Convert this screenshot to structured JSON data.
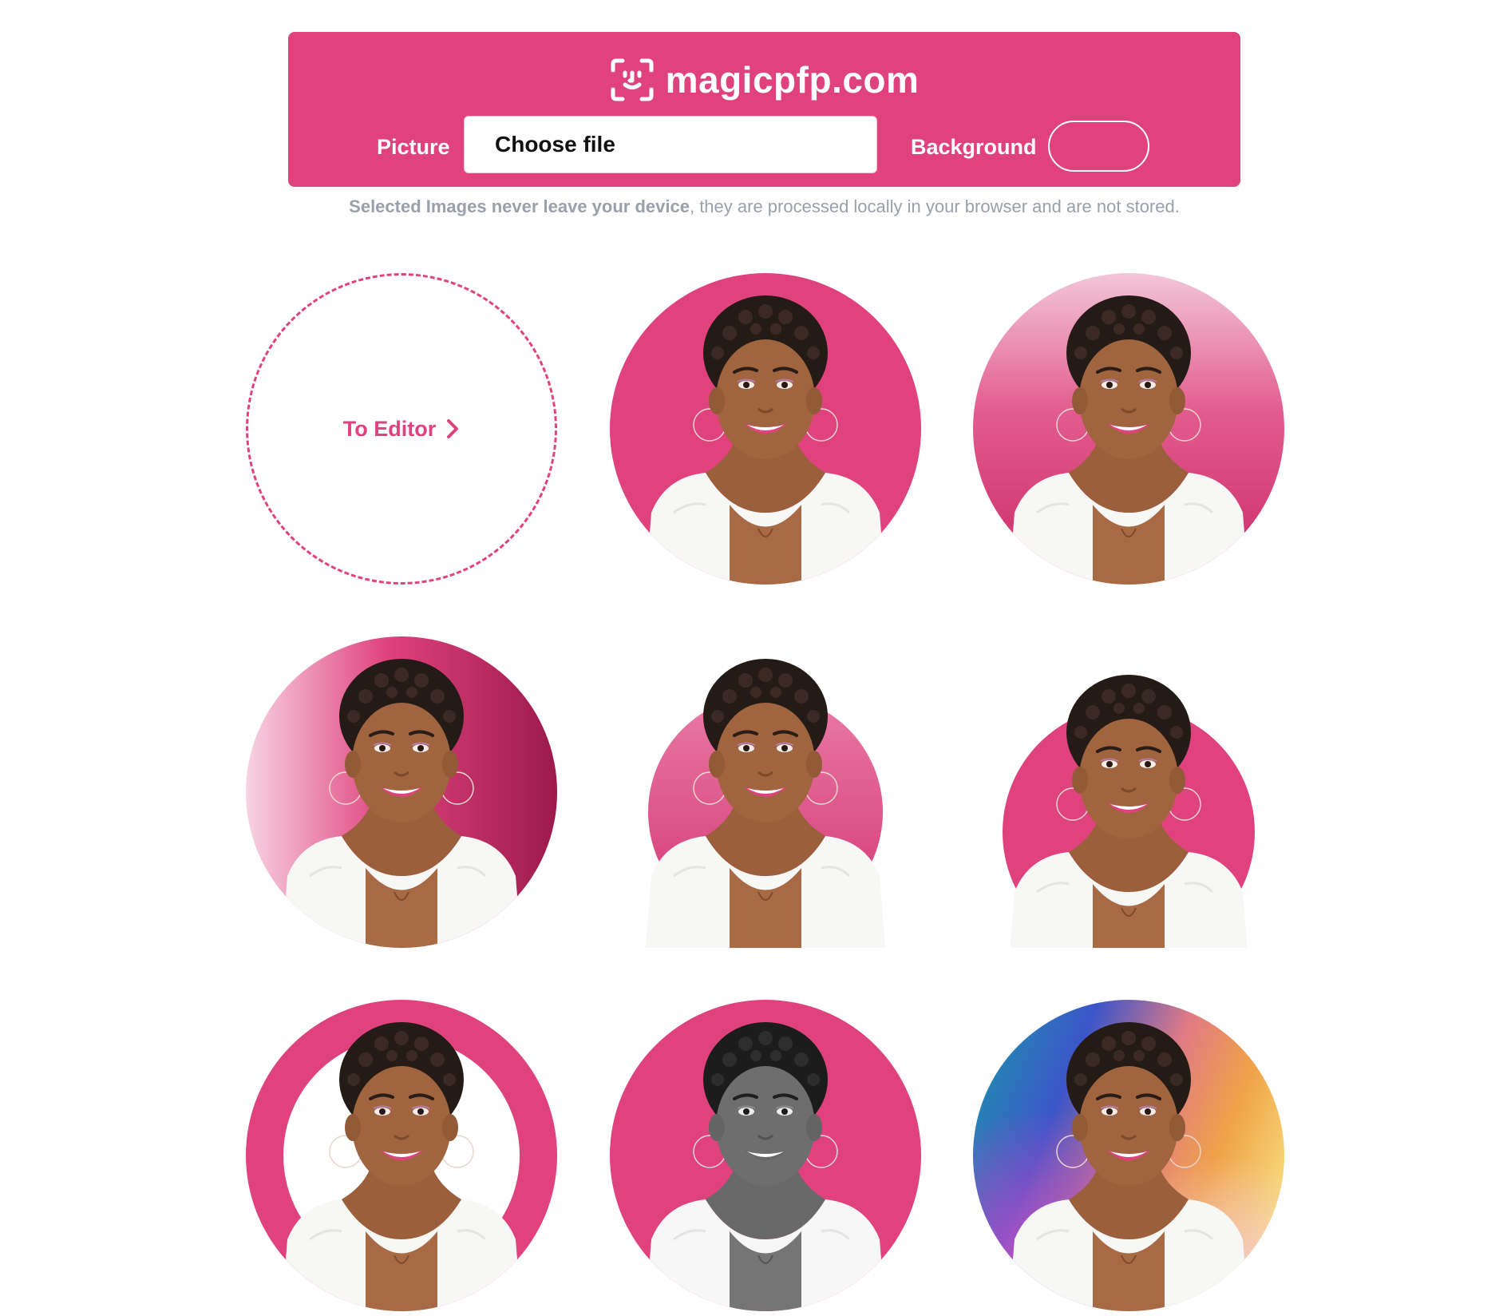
{
  "brand": {
    "name": "magicpfp.com",
    "logo_icon": "face-scan-icon"
  },
  "controls": {
    "picture_label": "Picture",
    "file_button": "Choose file",
    "background_label": "Background",
    "background_color": "#e0427e"
  },
  "notice": {
    "bold": "Selected Images never leave your device",
    "rest": ", they are processed locally in your browser and are not stored."
  },
  "editor_tile": {
    "label": "To Editor",
    "icon": "chevron-right-icon"
  },
  "previews": [
    {
      "style": "solid-circle"
    },
    {
      "style": "vertical-gradient-circle"
    },
    {
      "style": "horizontal-gradient-circle"
    },
    {
      "style": "pop-out-gradient-circle"
    },
    {
      "style": "pop-out-circle"
    },
    {
      "style": "ring-border"
    },
    {
      "style": "grayscale-on-color"
    },
    {
      "style": "rainbow-gradient-circle"
    }
  ],
  "colors": {
    "accent": "#e0427e",
    "accent_dark": "#a01c4e",
    "accent_light": "#f2c6d8",
    "notice_text": "#9aa0aa"
  }
}
